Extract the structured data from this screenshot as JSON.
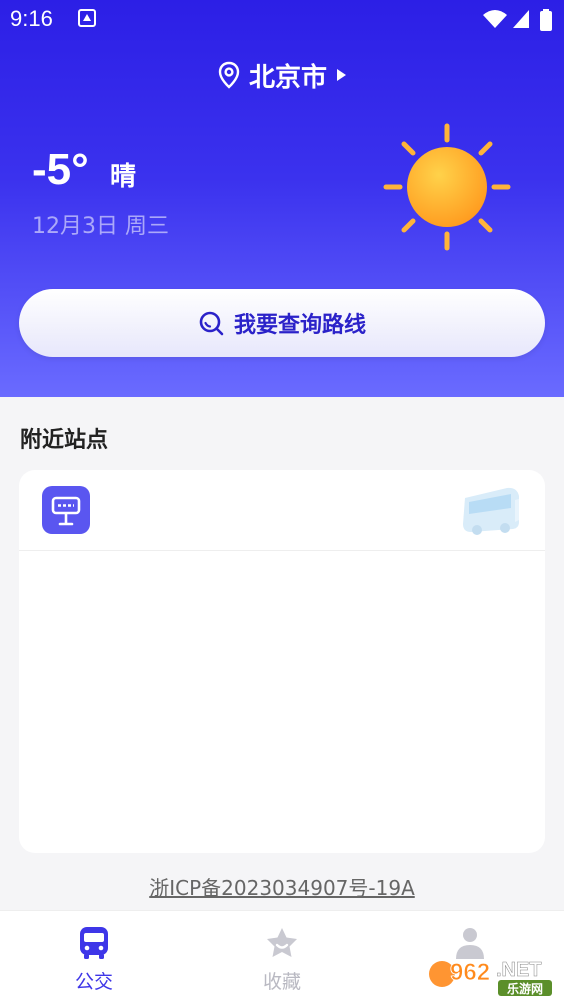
{
  "status_bar": {
    "time": "9:16"
  },
  "header": {
    "city": "北京市"
  },
  "weather": {
    "temperature": "-5°",
    "condition": "晴",
    "date": "12月3日 周三"
  },
  "search": {
    "label": "我要查询路线"
  },
  "nearby": {
    "title": "附近站点"
  },
  "footer": {
    "icp": "浙ICP备2023034907号-19A"
  },
  "tabs": [
    {
      "label": "公交",
      "active": true
    },
    {
      "label": "收藏",
      "active": false
    },
    {
      "label": "",
      "active": false
    }
  ],
  "watermark": {
    "brand": "962.NET",
    "sub": "乐游网"
  },
  "colors": {
    "accent": "#3a2ff0",
    "sun": "#ffa82a",
    "active_tab": "#3e36e8",
    "inactive_tab": "#b9b9c2"
  }
}
